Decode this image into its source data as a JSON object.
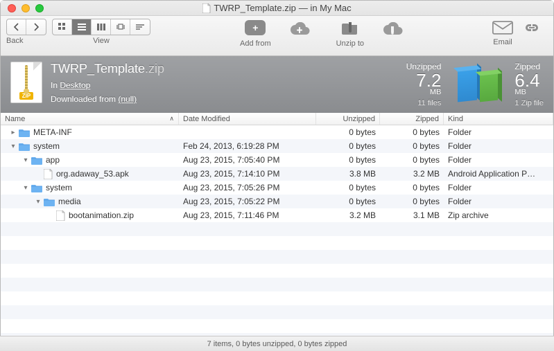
{
  "window": {
    "title_prefix": "TWRP_Template.zip",
    "title_suffix": "— in My Mac"
  },
  "toolbar": {
    "back_label": "Back",
    "view_label": "View",
    "addfrom_label": "Add from",
    "unzipto_label": "Unzip to",
    "email_label": "Email"
  },
  "hero": {
    "zip_badge": "ZIP",
    "filename": "TWRP_Template",
    "ext": ".zip",
    "in_prefix": "In ",
    "in_location": "Desktop",
    "downloaded_prefix": "Downloaded from ",
    "downloaded_src": "(null)",
    "unzipped_label": "Unzipped",
    "unzipped_value": "7.2",
    "unzipped_unit": "MB",
    "unzipped_sub": "11 files",
    "zipped_label": "Zipped",
    "zipped_value": "6.4",
    "zipped_unit": "MB",
    "zipped_sub": "1 Zip file"
  },
  "columns": {
    "name": "Name",
    "date": "Date Modified",
    "unzipped": "Unzipped",
    "zipped": "Zipped",
    "kind": "Kind"
  },
  "rows": [
    {
      "indent": 0,
      "disclosure": "right",
      "icon": "folder",
      "name": "META-INF",
      "date": "",
      "unzipped": "0 bytes",
      "zipped": "0 bytes",
      "kind": "Folder"
    },
    {
      "indent": 0,
      "disclosure": "down",
      "icon": "folder",
      "name": "system",
      "date": "Feb 24, 2013, 6:19:28 PM",
      "unzipped": "0 bytes",
      "zipped": "0 bytes",
      "kind": "Folder"
    },
    {
      "indent": 1,
      "disclosure": "down",
      "icon": "folder",
      "name": "app",
      "date": "Aug 23, 2015, 7:05:40 PM",
      "unzipped": "0 bytes",
      "zipped": "0 bytes",
      "kind": "Folder"
    },
    {
      "indent": 2,
      "disclosure": "none",
      "icon": "file",
      "name": "org.adaway_53.apk",
      "date": "Aug 23, 2015, 7:14:10 PM",
      "unzipped": "3.8 MB",
      "zipped": "3.2 MB",
      "kind": "Android Application P…"
    },
    {
      "indent": 1,
      "disclosure": "down",
      "icon": "folder",
      "name": "system",
      "date": "Aug 23, 2015, 7:05:26 PM",
      "unzipped": "0 bytes",
      "zipped": "0 bytes",
      "kind": "Folder"
    },
    {
      "indent": 2,
      "disclosure": "down",
      "icon": "folder",
      "name": "media",
      "date": "Aug 23, 2015, 7:05:22 PM",
      "unzipped": "0 bytes",
      "zipped": "0 bytes",
      "kind": "Folder"
    },
    {
      "indent": 3,
      "disclosure": "none",
      "icon": "file",
      "name": "bootanimation.zip",
      "date": "Aug 23, 2015, 7:11:46 PM",
      "unzipped": "3.2 MB",
      "zipped": "3.1 MB",
      "kind": "Zip archive"
    }
  ],
  "status": "7 items, 0 bytes unzipped, 0 bytes zipped"
}
